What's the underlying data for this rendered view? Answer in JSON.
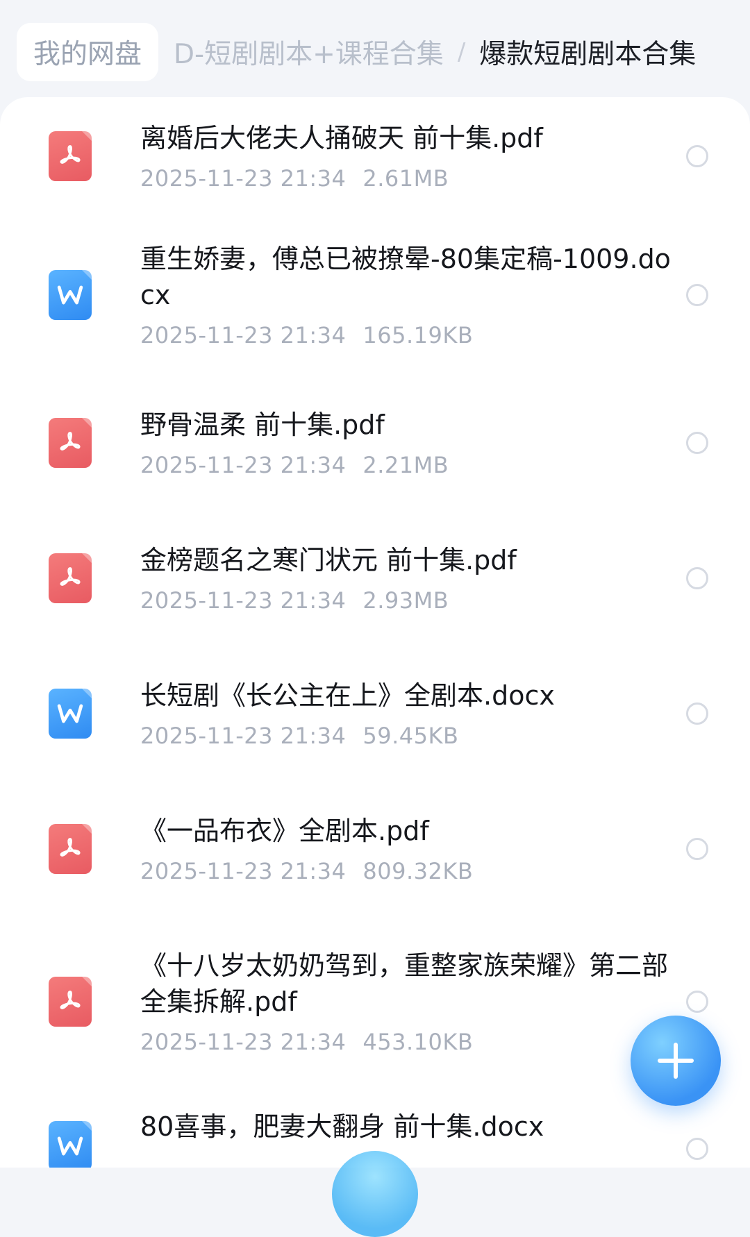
{
  "breadcrumb": {
    "home": "我的网盘",
    "parent": "D-短剧剧本+课程合集",
    "separator": "/",
    "current": "爆款短剧剧本合集"
  },
  "files": [
    {
      "name": "离婚后大佬夫人捅破天 前十集.pdf",
      "date": "2025-11-23  21:34",
      "size": "2.61MB",
      "type": "pdf",
      "icon": "pdf-file-icon"
    },
    {
      "name": "重生娇妻，傅总已被撩晕-80集定稿-1009.docx",
      "date": "2025-11-23  21:34",
      "size": "165.19KB",
      "type": "doc",
      "icon": "word-file-icon"
    },
    {
      "name": "野骨温柔 前十集.pdf",
      "date": "2025-11-23  21:34",
      "size": "2.21MB",
      "type": "pdf",
      "icon": "pdf-file-icon"
    },
    {
      "name": "金榜题名之寒门状元 前十集.pdf",
      "date": "2025-11-23  21:34",
      "size": "2.93MB",
      "type": "pdf",
      "icon": "pdf-file-icon"
    },
    {
      "name": "长短剧《长公主在上》全剧本.docx",
      "date": "2025-11-23  21:34",
      "size": "59.45KB",
      "type": "doc",
      "icon": "word-file-icon"
    },
    {
      "name": "《一品布衣》全剧本.pdf",
      "date": "2025-11-23  21:34",
      "size": "809.32KB",
      "type": "pdf",
      "icon": "pdf-file-icon"
    },
    {
      "name": "《十八岁太奶奶驾到，重整家族荣耀》第二部全集拆解.pdf",
      "date": "2025-11-23  21:34",
      "size": "453.10KB",
      "type": "pdf",
      "icon": "pdf-file-icon"
    },
    {
      "name": "80喜事，肥妻大翻身 前十集.docx",
      "date": "",
      "size": "",
      "type": "doc",
      "icon": "word-file-icon"
    }
  ],
  "fab": {
    "icon": "plus-icon"
  },
  "colors": {
    "pdf": "#e85b62",
    "doc": "#2f8bf2",
    "accent": "#3a93f5"
  }
}
